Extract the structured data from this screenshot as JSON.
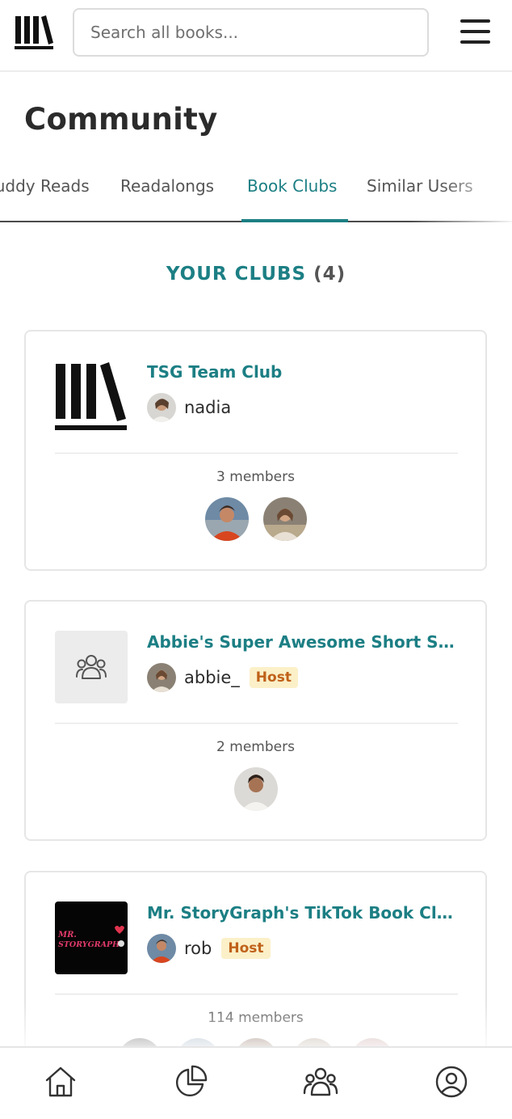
{
  "header": {
    "search_placeholder": "Search all books..."
  },
  "page": {
    "title": "Community"
  },
  "tabs": [
    {
      "label": "Buddy Reads"
    },
    {
      "label": "Readalongs"
    },
    {
      "label": "Book Clubs",
      "active": true
    },
    {
      "label": "Similar Users"
    }
  ],
  "section": {
    "label": "YOUR CLUBS",
    "count": "(4)"
  },
  "clubs": [
    {
      "title": "TSG Team Club",
      "host_name": "nadia",
      "host_badge": "",
      "members_label": "3 members",
      "cover": "storygraph-logo"
    },
    {
      "title": "Abbie's Super Awesome Short Stories Club",
      "host_name": "abbie_",
      "host_badge": "Host",
      "members_label": "2 members",
      "cover": "group-icon"
    },
    {
      "title": "Mr. StoryGraph's TikTok Book Club!",
      "host_name": "rob",
      "host_badge": "Host",
      "members_label": "114 members",
      "cover": "tiktok-cover",
      "cover_text": "MR. STORYGRAPH"
    }
  ],
  "bottom_nav": [
    "home-icon",
    "stats-icon",
    "community-icon",
    "profile-icon"
  ],
  "colors": {
    "accent": "#1c7f84",
    "badge_bg": "#fbf0c8",
    "badge_text": "#c0611a"
  }
}
